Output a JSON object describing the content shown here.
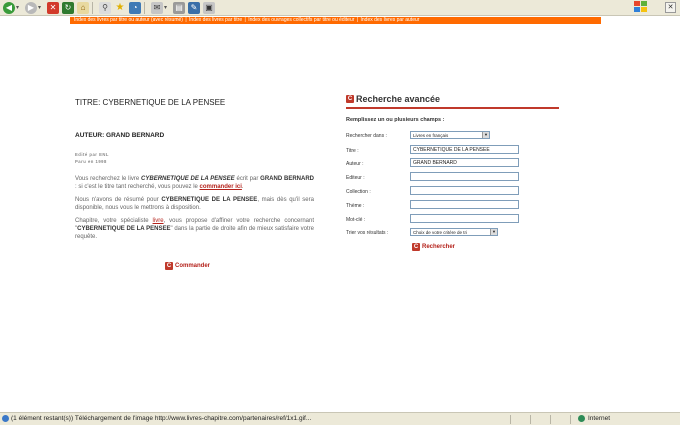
{
  "navbar": {
    "links": [
      "Index des livres par titre ou auteur (avec résumé)",
      "Index des livres par titre",
      "Index des ouvrages collectifs par titre ou éditeur",
      "Index des livres par auteur"
    ],
    "separator": "|"
  },
  "book": {
    "title": "TITRE: CYBERNETIQUE DE LA PENSEE",
    "author": "AUTEUR: GRAND BERNARD",
    "editor_line": "Edité par ENL",
    "year_line": "Paru en 1998",
    "para1_a": "Vous recherchez le livre ",
    "para1_title": "CYBERNETIQUE DE LA PENSEE",
    "para1_b": " écrit par ",
    "para1_author": "GRAND BERNARD",
    "para1_c": " : si c'est le titre tant recherché, vous pouvez le ",
    "para1_link": "commander ici",
    "para1_end": ".",
    "para2_a": "Nous n'avons de résumé pour ",
    "para2_title": "CYBERNETIQUE DE LA PENSEE",
    "para2_b": ", mais dès qu'il sera disponible, nous vous le mettrons à disposition.",
    "para3_a": "Chapitre, votre spécialiste ",
    "para3_link": "livre",
    "para3_b": ", vous propose d'affiner votre recherche concernant \"",
    "para3_title": "CYBERNETIQUE DE LA PENSEE",
    "para3_c": "\" dans la partie de droite afin de mieux satisfaire votre requête.",
    "order_label": "Commander"
  },
  "search": {
    "heading": "Recherche avancée",
    "subheading": "Remplissez un ou plusieurs champs :",
    "search_in_label": "Rechercher dans :",
    "search_in_value": "Livres en français",
    "title_label": "Titre :",
    "title_value": "CYBERNETIQUE DE LA PENSEE",
    "author_label": "Auteur :",
    "author_value": "GRAND BERNARD",
    "publisher_label": "Editeur :",
    "publisher_value": "",
    "collection_label": "Collection :",
    "collection_value": "",
    "theme_label": "Thème :",
    "theme_value": "",
    "keyword_label": "Mot-clé :",
    "keyword_value": "",
    "sort_label": "Trier vos résultats :",
    "sort_value": "Choix de votre critère de tri",
    "submit_label": "Rechercher"
  },
  "status": {
    "message": "(1 élément restant(s)) Téléchargement de l'image http://www.livres-chapitre.com/partenaires/ref/1x1.gif...",
    "zone": "Internet"
  },
  "colors": {
    "nav_orange": "#ff6a00",
    "accent_red": "#b4221b"
  }
}
